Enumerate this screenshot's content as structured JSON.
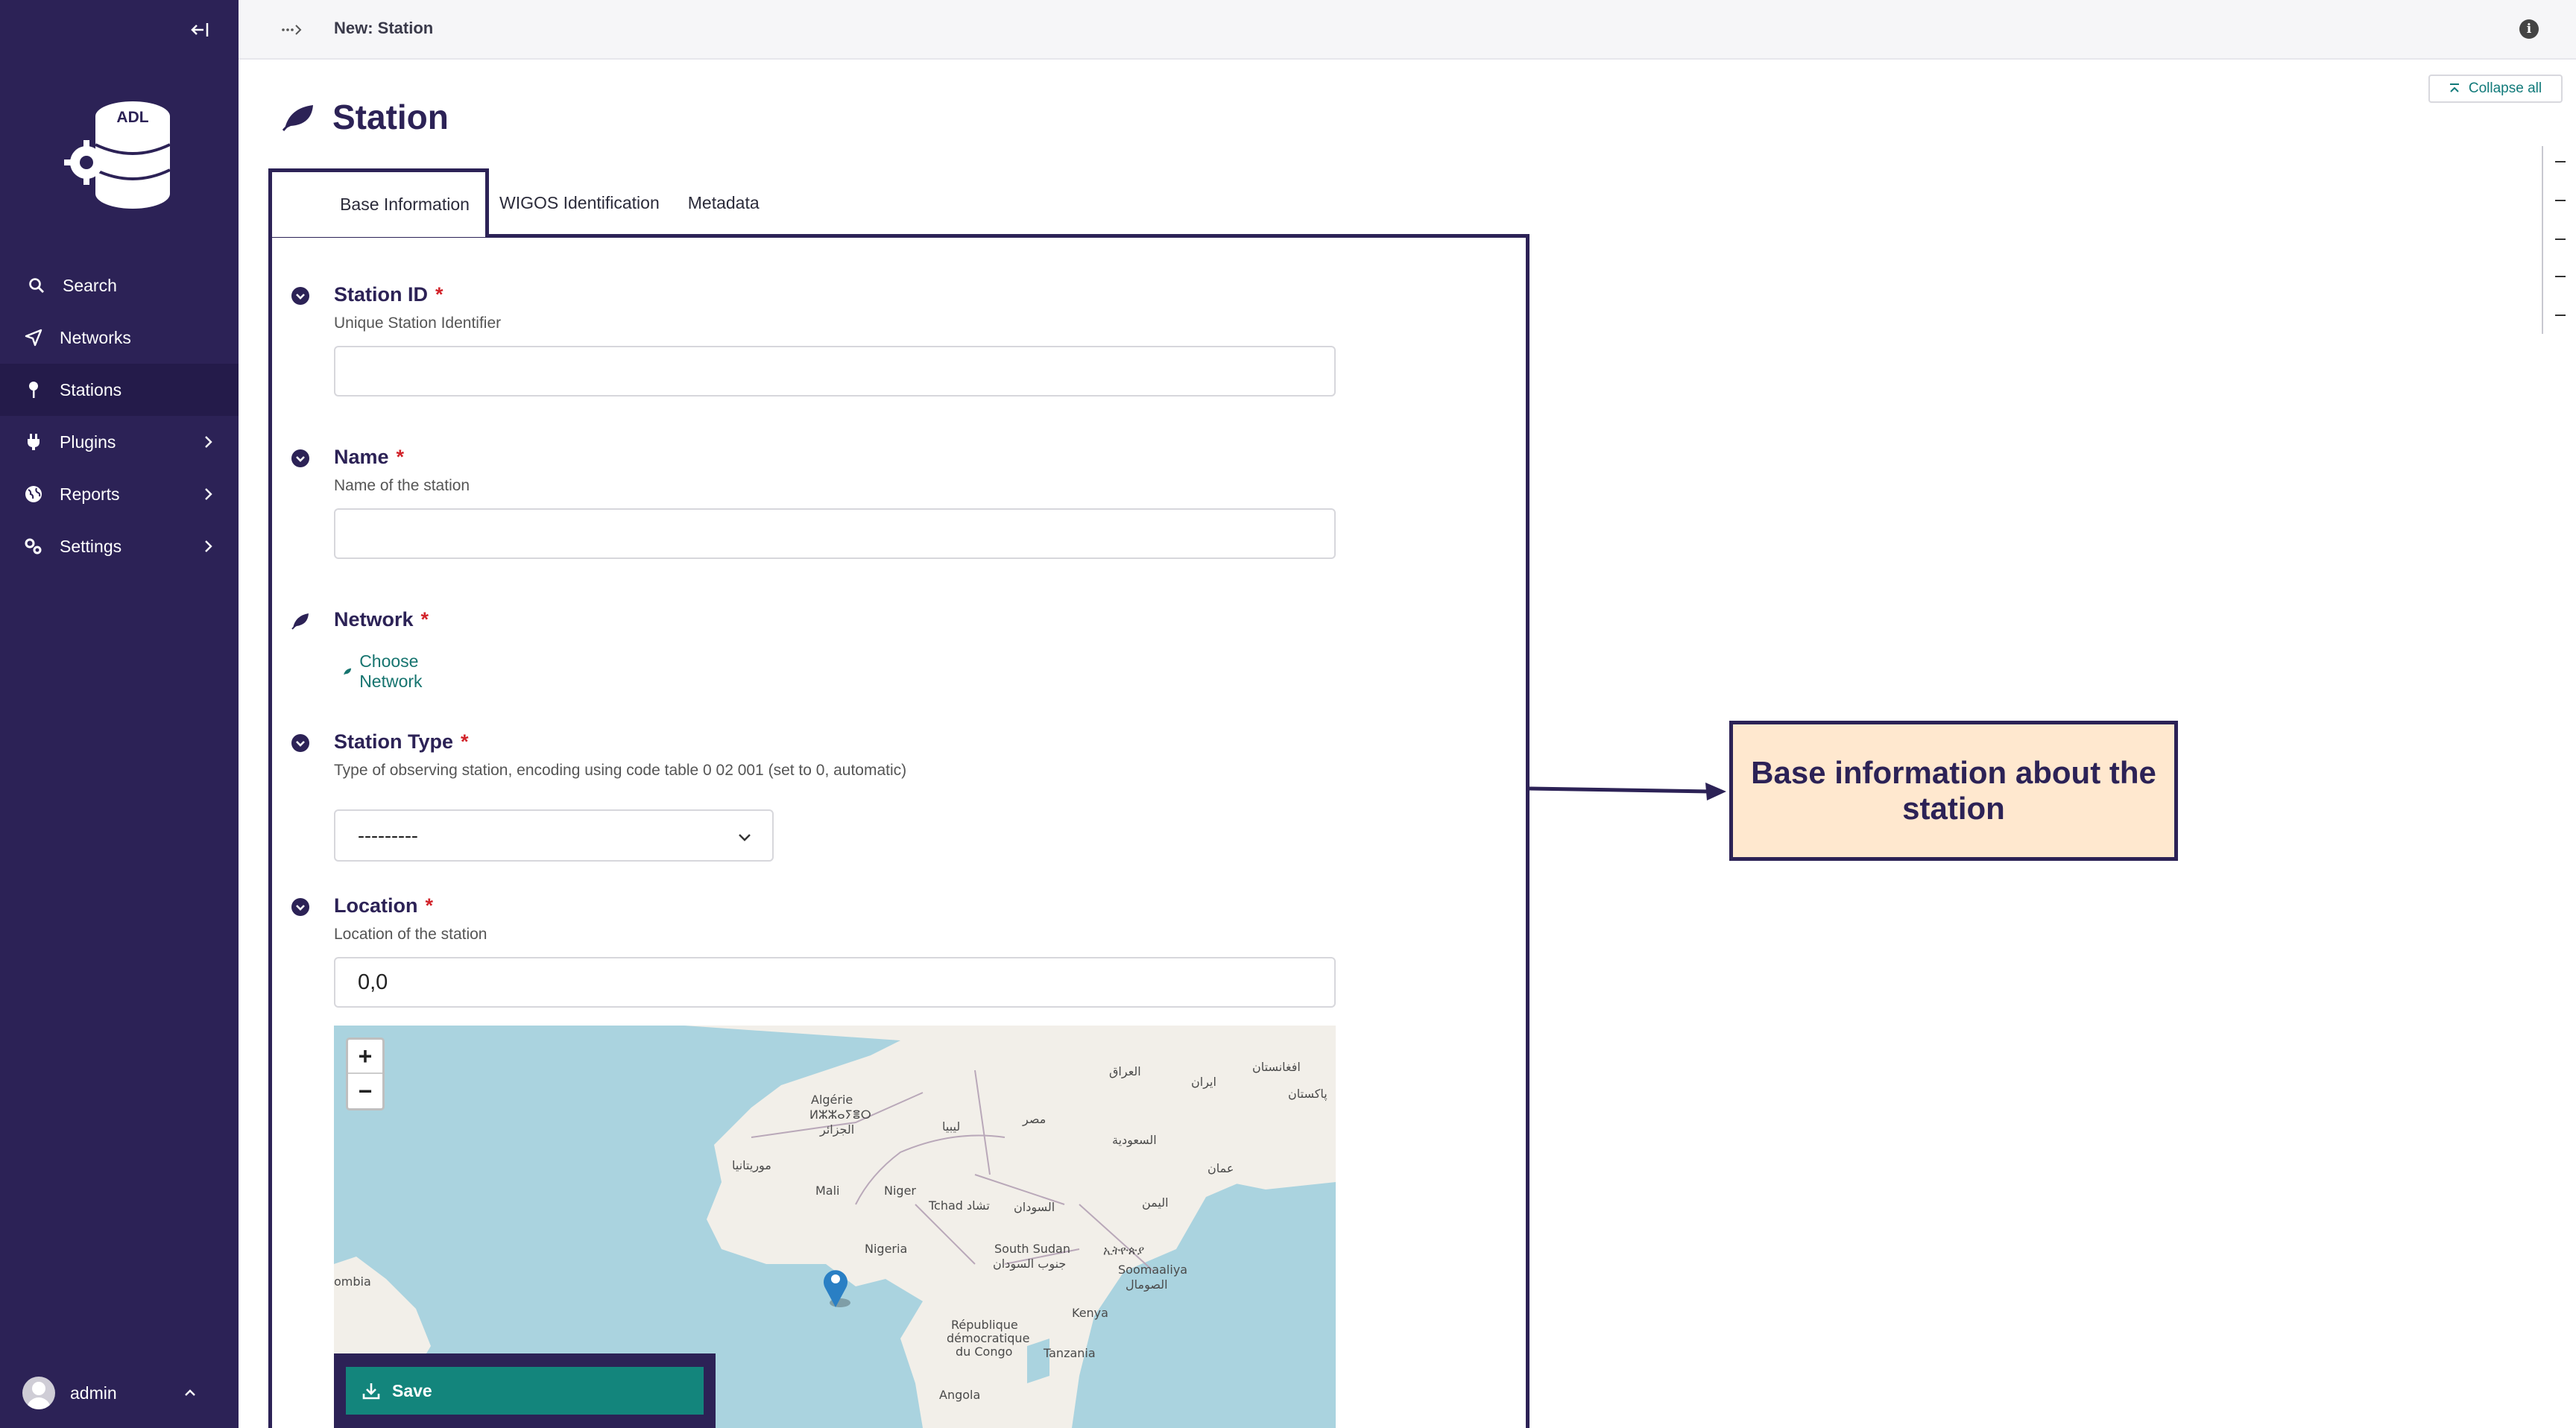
{
  "sidebar": {
    "logo_text": "ADL",
    "nav": [
      {
        "label": "Search",
        "icon": "search-icon"
      },
      {
        "label": "Networks",
        "icon": "send-icon"
      },
      {
        "label": "Stations",
        "icon": "pin-icon",
        "active": true
      },
      {
        "label": "Plugins",
        "icon": "plug-icon",
        "has_children": true
      },
      {
        "label": "Reports",
        "icon": "globe-icon",
        "has_children": true
      },
      {
        "label": "Settings",
        "icon": "cogs-icon",
        "has_children": true
      }
    ],
    "user": "admin"
  },
  "topbar": {
    "title": "New: Station"
  },
  "main": {
    "collapse_all": "Collapse all",
    "page_title": "Station",
    "tabs": [
      "Base Information",
      "WIGOS Identification",
      "Metadata"
    ],
    "fields": {
      "station_id": {
        "label": "Station ID",
        "required": "*",
        "help": "Unique Station Identifier",
        "value": ""
      },
      "name": {
        "label": "Name",
        "required": "*",
        "help": "Name of the station",
        "value": ""
      },
      "network": {
        "label": "Network",
        "required": "*",
        "action": "Choose Network"
      },
      "station_type": {
        "label": "Station Type",
        "required": "*",
        "help": "Type of observing station, encoding using code table 0 02 001 (set to 0, automatic)",
        "value": "---------"
      },
      "location": {
        "label": "Location",
        "required": "*",
        "help": "Location of the station",
        "value": "0,0"
      }
    },
    "map": {
      "zoom_in": "+",
      "zoom_out": "−",
      "labels": [
        "Algérie",
        "ⵍⵣⵣⴰⵢⴻⵔ",
        "الجزائر",
        "ليبيا",
        "مصر",
        "موريتانيا",
        "Mali",
        "Niger",
        "Tchad تشاد",
        "السودان",
        "Nigeria",
        "South Sudan",
        "جنوب السودان",
        "Soomaaliya",
        "الصومال",
        "Kenya",
        "République",
        "démocratique",
        "du Congo",
        "Tanzania",
        "Angola",
        "السعودية",
        "عمان",
        "اليمن",
        "العراق",
        "ایران",
        "افغانستان",
        "پاکستان",
        "ombia",
        "ኢትዮጵያ"
      ]
    },
    "save": "Save"
  },
  "annotation": {
    "text": "Base information about the station"
  },
  "colors": {
    "sidebar": "#2c2256",
    "accent": "#13857c",
    "required": "#d2232a",
    "callout_bg": "#ffe8cf"
  }
}
